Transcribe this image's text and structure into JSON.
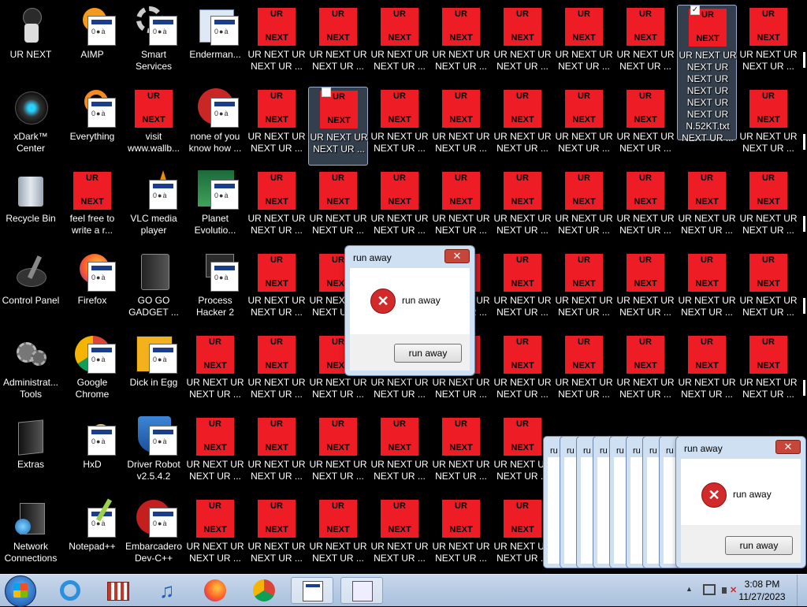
{
  "desktop": {
    "column1": [
      "UR NEXT",
      "xDark™ Center",
      "Recycle Bin",
      "Control Panel",
      "Administrat... Tools",
      "Extras",
      "Network Connections"
    ],
    "column2": [
      "AIMP",
      "Everything",
      "feel free to write a r...",
      "Firefox",
      "Google Chrome",
      "HxD",
      "Notepad++"
    ],
    "column3": [
      "Smart Services",
      "visit www.wallb...",
      "VLC media player",
      "GO GO GADGET ...",
      "Dick in Egg",
      "Driver Robot v2.5.4.2",
      "Embarcadero Dev-C++"
    ],
    "column4": [
      "Enderman...",
      "none of you know how ...",
      "Planet Evolutio...",
      "Process Hacker 2",
      "UR NEXT UR NEXT UR ...",
      "UR NEXT UR NEXT UR ...",
      "UR NEXT UR NEXT UR ..."
    ],
    "ur_tile_top": "UR",
    "ur_tile_bottom": "NEXT",
    "ur_label": "UR NEXT UR NEXT UR ...",
    "expanded_label": "UR NEXT UR NEXT UR NEXT UR NEXT UR NEXT UR NEXT UR N.52KT.txt NEXT UR ...",
    "checkbox_mark": "✓"
  },
  "dialog_main": {
    "title": "run away",
    "message": "run away",
    "button": "run away",
    "close": "✕",
    "error_glyph": "✕"
  },
  "dialog_stack": {
    "title": "run away",
    "message": "run away",
    "button": "run away",
    "close": "✕",
    "error_glyph": "✕",
    "mini_title": "ru"
  },
  "taskbar": {
    "clock_time": "3:08 PM",
    "clock_date": "11/27/2023",
    "tray_up": "▲"
  }
}
